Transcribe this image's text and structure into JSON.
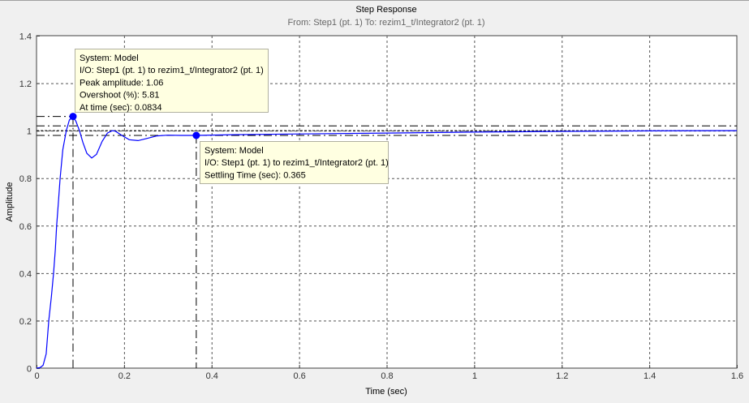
{
  "chart_data": {
    "type": "line",
    "title": "Step Response",
    "subtitle": "From: Step1 (pt. 1)  To: rezim1_t/Integrator2 (pt. 1)",
    "xlabel": "Time (sec)",
    "ylabel": "Amplitude",
    "xlim": [
      0,
      1.6
    ],
    "ylim": [
      0,
      1.4
    ],
    "xticks": [
      0,
      0.2,
      0.4,
      0.6,
      0.8,
      1,
      1.2,
      1.4,
      1.6
    ],
    "xtick_labels": [
      "0",
      "0.2",
      "0.4",
      "0.6",
      "0.8",
      "1",
      "1.2",
      "1.4",
      "1.6"
    ],
    "yticks": [
      0,
      0.2,
      0.4,
      0.6,
      0.8,
      1,
      1.2,
      1.4
    ],
    "ytick_labels": [
      "0",
      "0.2",
      "0.4",
      "0.6",
      "0.8",
      "1",
      "1.2",
      "1.4"
    ],
    "grid": true,
    "series": [
      {
        "name": "Model",
        "color": "#0000ff",
        "x": [
          0,
          0.008,
          0.015,
          0.022,
          0.028,
          0.034,
          0.039,
          0.043,
          0.046,
          0.05,
          0.054,
          0.06,
          0.068,
          0.075,
          0.0834,
          0.09,
          0.098,
          0.106,
          0.115,
          0.126,
          0.137,
          0.15,
          0.162,
          0.173,
          0.18,
          0.195,
          0.212,
          0.232,
          0.25,
          0.275,
          0.3,
          0.33,
          0.365,
          0.45,
          0.6,
          0.8,
          1.0,
          1.2,
          1.4,
          1.6
        ],
        "y": [
          0,
          0.002,
          0.012,
          0.06,
          0.2,
          0.3,
          0.4,
          0.5,
          0.6,
          0.7,
          0.8,
          0.92,
          1.0,
          1.045,
          1.058,
          1.04,
          1.0,
          0.95,
          0.905,
          0.885,
          0.9,
          0.955,
          0.99,
          1.0,
          0.998,
          0.98,
          0.962,
          0.958,
          0.966,
          0.978,
          0.981,
          0.98,
          0.98,
          0.983,
          0.986,
          0.99,
          0.994,
          0.997,
          0.999,
          1.0
        ]
      }
    ],
    "reference_lines": {
      "final_value": 1,
      "settling_bounds": [
        0.98,
        1.02
      ]
    },
    "markers": [
      {
        "name": "peak",
        "x": 0.0834,
        "y": 1.06,
        "lines": [
          "System: Model",
          "I/O: Step1 (pt. 1) to rezim1_t/Integrator2 (pt. 1)",
          "Peak amplitude: 1.06",
          "Overshoot (%): 5.81",
          "At time (sec): 0.0834"
        ]
      },
      {
        "name": "settling",
        "x": 0.365,
        "y": 0.98,
        "lines": [
          "System: Model",
          "I/O: Step1 (pt. 1) to rezim1_t/Integrator2 (pt. 1)",
          "Settling Time (sec): 0.365"
        ]
      }
    ]
  }
}
